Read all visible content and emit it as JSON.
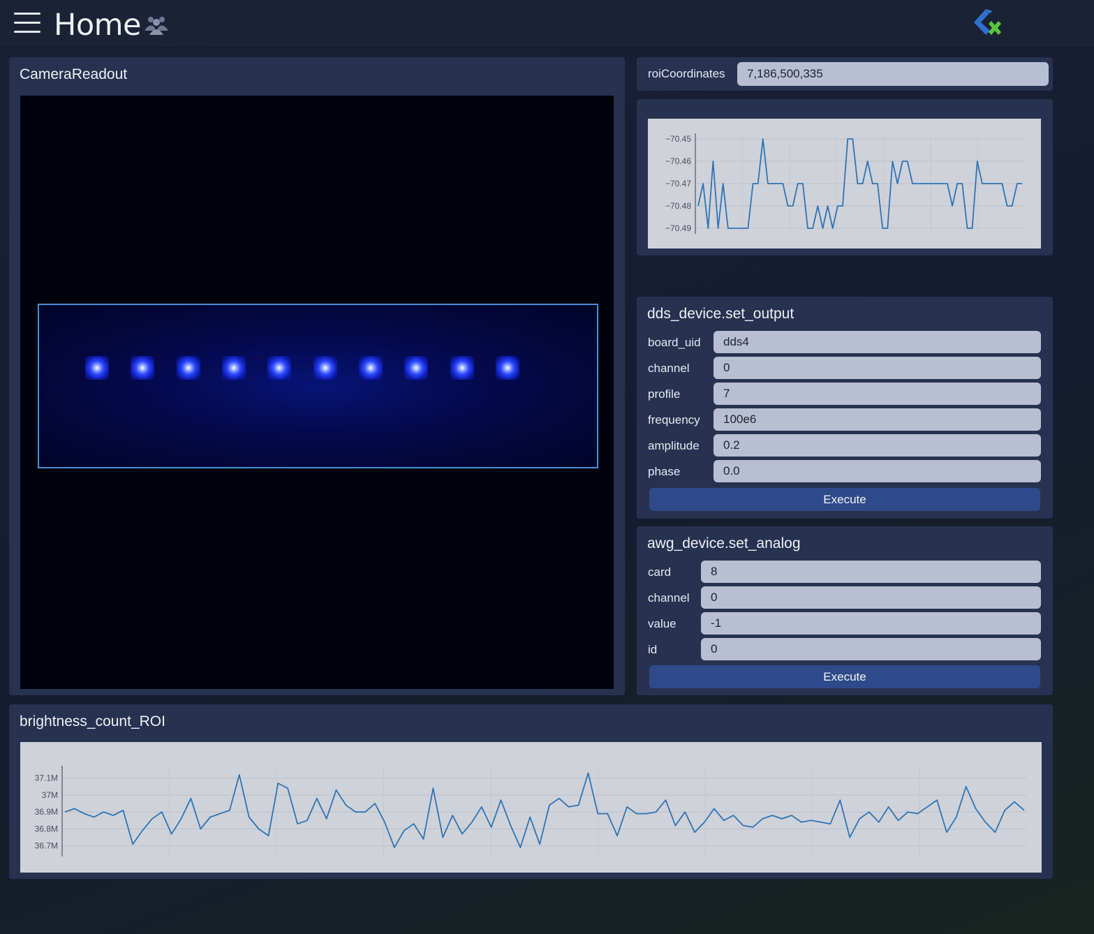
{
  "header": {
    "title": "Home",
    "menu_icon": "hamburger-menu-icon",
    "users_icon": "users-icon",
    "logo": "app-logo"
  },
  "camera": {
    "title": "CameraReadout",
    "ion_count": 10
  },
  "roi": {
    "label": "roiCoordinates",
    "value": "7,186,500,335"
  },
  "dds": {
    "title": "dds_device.set_output",
    "fields": [
      {
        "label": "board_uid",
        "value": "dds4"
      },
      {
        "label": "channel",
        "value": "0"
      },
      {
        "label": "profile",
        "value": "7"
      },
      {
        "label": "frequency",
        "value": "100e6"
      },
      {
        "label": "amplitude",
        "value": "0.2"
      },
      {
        "label": "phase",
        "value": "0.0"
      }
    ],
    "execute_label": "Execute"
  },
  "awg": {
    "title": "awg_device.set_analog",
    "fields": [
      {
        "label": "card",
        "value": "8"
      },
      {
        "label": "channel",
        "value": "0"
      },
      {
        "label": "value",
        "value": "-1"
      },
      {
        "label": "id",
        "value": "0"
      }
    ],
    "execute_label": "Execute"
  },
  "brightness": {
    "title": "brightness_count_ROI"
  },
  "chart_data": [
    {
      "type": "line",
      "title": "",
      "xlabel": "",
      "ylabel": "",
      "ylim": [
        -70.49,
        -70.45
      ],
      "yticks": [
        "−70.45",
        "−70.46",
        "−70.47",
        "−70.48",
        "−70.49"
      ],
      "grid": true,
      "line_color": "#2e74b5",
      "series": [
        {
          "values": [
            -70.48,
            -70.47,
            -70.49,
            -70.46,
            -70.49,
            -70.47,
            -70.49,
            -70.49,
            -70.49,
            -70.49,
            -70.49,
            -70.47,
            -70.47,
            -70.45,
            -70.47,
            -70.47,
            -70.47,
            -70.47,
            -70.48,
            -70.48,
            -70.47,
            -70.47,
            -70.49,
            -70.49,
            -70.48,
            -70.49,
            -70.48,
            -70.49,
            -70.48,
            -70.48,
            -70.45,
            -70.45,
            -70.47,
            -70.47,
            -70.46,
            -70.47,
            -70.47,
            -70.49,
            -70.49,
            -70.46,
            -70.47,
            -70.46,
            -70.46,
            -70.47,
            -70.47,
            -70.47,
            -70.47,
            -70.47,
            -70.47,
            -70.47,
            -70.47,
            -70.48,
            -70.47,
            -70.47,
            -70.49,
            -70.49,
            -70.46,
            -70.47,
            -70.47,
            -70.47,
            -70.47,
            -70.47,
            -70.48,
            -70.48,
            -70.47,
            -70.47
          ]
        }
      ]
    },
    {
      "type": "line",
      "title": "",
      "xlabel": "",
      "ylabel": "",
      "ylim": [
        36.67,
        37.14
      ],
      "yticks": [
        "37.1M",
        "37M",
        "36.9M",
        "36.8M",
        "36.7M"
      ],
      "grid": true,
      "line_color": "#2e74b5",
      "series": [
        {
          "values": [
            36.9,
            36.92,
            36.89,
            36.87,
            36.9,
            36.88,
            36.91,
            36.71,
            36.79,
            36.86,
            36.9,
            36.77,
            36.86,
            36.98,
            36.8,
            36.87,
            36.89,
            36.91,
            37.12,
            36.87,
            36.8,
            36.76,
            37.07,
            37.04,
            36.83,
            36.85,
            36.98,
            36.86,
            37.03,
            36.94,
            36.9,
            36.9,
            36.95,
            36.84,
            36.69,
            36.79,
            36.83,
            36.74,
            37.04,
            36.75,
            36.88,
            36.77,
            36.84,
            36.93,
            36.81,
            36.97,
            36.82,
            36.69,
            36.87,
            36.71,
            36.94,
            36.98,
            36.93,
            36.94,
            37.13,
            36.89,
            36.89,
            36.76,
            36.93,
            36.89,
            36.89,
            36.9,
            36.97,
            36.82,
            36.9,
            36.78,
            36.84,
            36.92,
            36.85,
            36.88,
            36.82,
            36.81,
            36.86,
            36.88,
            36.86,
            36.88,
            36.84,
            36.85,
            36.84,
            36.83,
            36.97,
            36.75,
            36.86,
            36.9,
            36.84,
            36.93,
            36.85,
            36.9,
            36.89,
            36.93,
            36.97,
            36.78,
            36.87,
            37.05,
            36.92,
            36.84,
            36.78,
            36.91,
            36.96,
            36.91
          ]
        }
      ]
    }
  ]
}
